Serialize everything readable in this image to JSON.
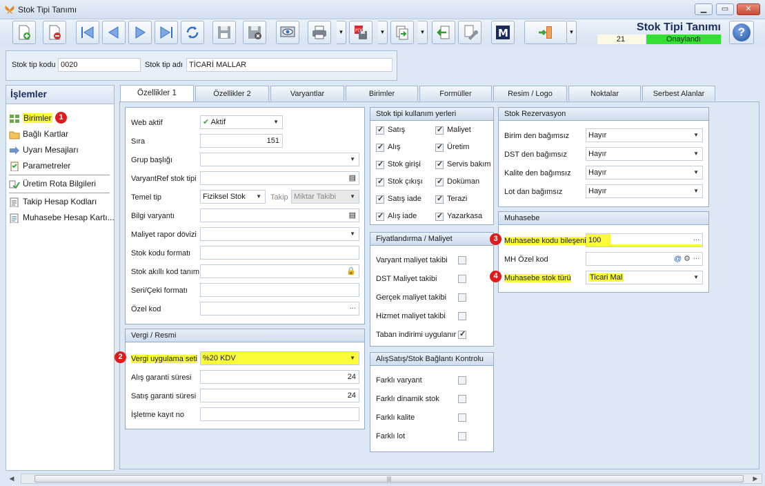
{
  "window": {
    "title": "Stok Tipi Tanımı",
    "min": "▁",
    "max": "▭",
    "close": "✕"
  },
  "header": {
    "title": "Stok Tipi Tanımı",
    "count": "21",
    "status": "Onaylandı"
  },
  "code": {
    "kod_label": "Stok tip kodu",
    "kod_value": "0020",
    "adi_label": "Stok tip adı",
    "adi_value": "TİCARİ MALLAR"
  },
  "side": {
    "title": "İşlemler",
    "items": [
      "Birimler",
      "Bağlı Kartlar",
      "Uyarı Mesajları",
      "Parametreler",
      "Üretim Rota Bilgileri",
      "Takip Hesap Kodları",
      "Muhasebe Hesap Kartı..."
    ]
  },
  "badges": [
    "1",
    "2",
    "3",
    "4"
  ],
  "tabs": [
    "Özellikler 1",
    "Özellikler 2",
    "Varyantlar",
    "Birimler",
    "Formüller",
    "Resim / Logo",
    "Noktalar",
    "Serbest Alanlar"
  ],
  "props": {
    "web_aktif": "Web aktif",
    "web_aktif_val": "Aktif",
    "sira": "Sıra",
    "sira_val": "151",
    "grup": "Grup başlığı",
    "varyantref": "VaryantRef stok tipi",
    "temel": "Temel tip",
    "temel_val": "Fiziksel Stok",
    "takip": "Takip",
    "takip_val": "Miktar Takibi",
    "bilgi": "Bilgi varyantı",
    "maliyet": "Maliyet rapor dövizi",
    "formati": "Stok kodu formatı",
    "akilli": "Stok akıllı kod tanımı",
    "seri": "Seri/Çeki formatı",
    "ozel": "Özel kod"
  },
  "vergi": {
    "title": "Vergi / Resmi",
    "seti": "Vergi uygulama seti",
    "seti_val": "%20 KDV",
    "alis": "Alış garanti süresi",
    "alis_val": "24",
    "satis": "Satış garanti süresi",
    "satis_val": "24",
    "isletme": "İşletme kayıt no"
  },
  "kullanim": {
    "title": "Stok tipi kullanım yerleri",
    "left": [
      "Satış",
      "Alış",
      "Stok girişi",
      "Stok çıkışı",
      "Satış iade",
      "Alış iade"
    ],
    "right": [
      "Maliyet",
      "Üretim",
      "Servis bakım",
      "Doküman",
      "Terazi",
      "Yazarkasa"
    ]
  },
  "fiyat": {
    "title": "Fiyatlandırma / Maliyet",
    "items": [
      "Varyant maliyet takibi",
      "DST Maliyet takibi",
      "Gerçek maliyet takibi",
      "Hizmet maliyet takibi",
      "Taban indirimi uygulanır"
    ]
  },
  "alissatis": {
    "title": "AlışSatış/Stok Bağlantı Kontrolu",
    "items": [
      "Farklı varyant",
      "Farklı dinamik stok",
      "Farklı kalite",
      "Farklı lot"
    ]
  },
  "rezerv": {
    "title": "Stok Rezervasyon",
    "items": [
      "Birim den bağımsız",
      "DST den bağımsız",
      "Kalite den bağımsız",
      "Lot dan bağımsız"
    ],
    "val": "Hayır"
  },
  "muhasebe": {
    "title": "Muhasebe",
    "bilesen": "Muhasebe kodu bileşeni",
    "bilesen_val": "100",
    "mh": "MH Özel kod",
    "tur": "Muhasebe stok türü",
    "tur_val": "Ticari Mal"
  },
  "colors": {
    "highlight": "#fafc3a",
    "status": "#33e133",
    "badge": "#e01b1b"
  }
}
